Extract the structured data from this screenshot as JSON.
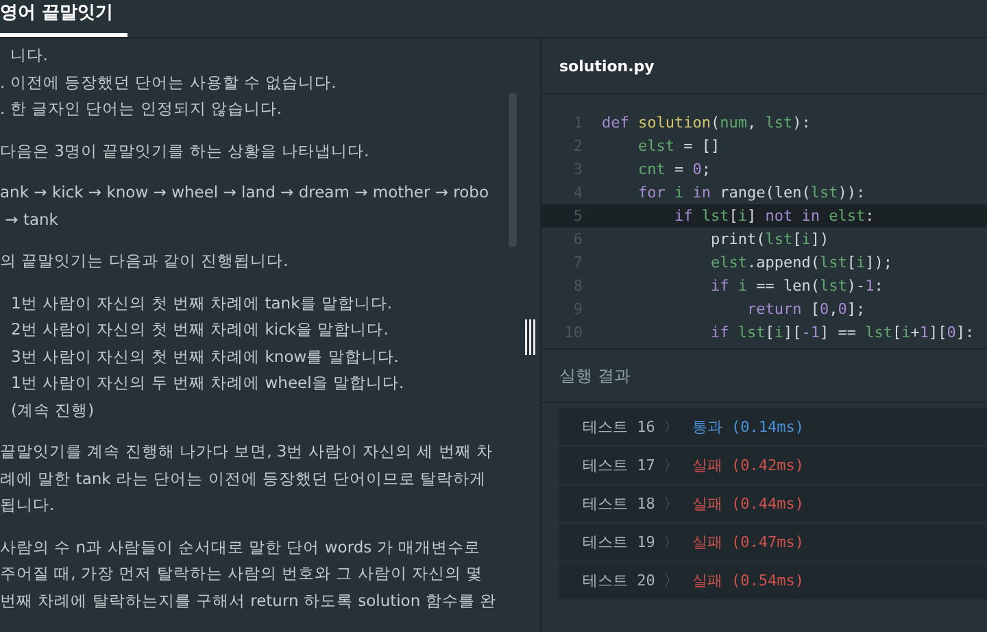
{
  "tabs": [
    {
      "label": "영어 끝말잇기",
      "selected": true
    }
  ],
  "description": {
    "blocks": [
      {
        "kind": "para",
        "text": "  니다."
      },
      {
        "kind": "para",
        "text": ". 이전에 등장했던 단어는 사용할 수 없습니다."
      },
      {
        "kind": "para",
        "text": ". 한 글자인 단어는 인정되지 않습니다."
      },
      {
        "kind": "gap"
      },
      {
        "kind": "para",
        "text": "다음은 3명이 끝말잇기를 하는 상황을 나타냅니다."
      },
      {
        "kind": "gap"
      },
      {
        "kind": "para",
        "text": "ank → kick → know → wheel → land → dream → mother → robo"
      },
      {
        "kind": "para",
        "text": " → tank"
      },
      {
        "kind": "gap"
      },
      {
        "kind": "para",
        "text": "의 끝말잇기는 다음과 같이 진행됩니다."
      },
      {
        "kind": "gap"
      },
      {
        "kind": "item",
        "text": "1번 사람이 자신의 첫 번째 차례에 tank를 말합니다."
      },
      {
        "kind": "item",
        "text": "2번 사람이 자신의 첫 번째 차례에 kick을 말합니다."
      },
      {
        "kind": "item",
        "text": "3번 사람이 자신의 첫 번째 차례에 know를 말합니다."
      },
      {
        "kind": "item",
        "text": "1번 사람이 자신의 두 번째 차례에 wheel을 말합니다."
      },
      {
        "kind": "item",
        "text": "(계속 진행)"
      },
      {
        "kind": "gap"
      },
      {
        "kind": "para",
        "text": "끝말잇기를 계속 진행해 나가다 보면, 3번 사람이 자신의 세 번째 차"
      },
      {
        "kind": "para",
        "text": "례에 말한 tank 라는 단어는 이전에 등장했던 단어이므로 탈락하게"
      },
      {
        "kind": "para",
        "text": "됩니다."
      },
      {
        "kind": "gap"
      },
      {
        "kind": "para",
        "text": "사람의 수 n과 사람들이 순서대로 말한 단어 words 가 매개변수로"
      },
      {
        "kind": "para",
        "text": "주어질 때, 가장 먼저 탈락하는 사람의 번호와 그 사람이 자신의 몇"
      },
      {
        "kind": "para",
        "text": "번째 차례에 탈락하는지를 구해서 return 하도록 solution 함수를 완"
      }
    ]
  },
  "editor": {
    "filename": "solution.py",
    "lines": [
      {
        "number": "1",
        "highlighted": false,
        "tokens": [
          {
            "kind": "kw",
            "text": "def "
          },
          {
            "kind": "fn",
            "text": "solution"
          },
          {
            "kind": "plain",
            "text": "("
          },
          {
            "kind": "var",
            "text": "num"
          },
          {
            "kind": "plain",
            "text": ", "
          },
          {
            "kind": "var",
            "text": "lst"
          },
          {
            "kind": "plain",
            "text": "):"
          }
        ]
      },
      {
        "number": "2",
        "highlighted": false,
        "tokens": [
          {
            "kind": "var",
            "text": "    elst"
          },
          {
            "kind": "plain",
            "text": " = []"
          }
        ]
      },
      {
        "number": "3",
        "highlighted": false,
        "tokens": [
          {
            "kind": "var",
            "text": "    cnt"
          },
          {
            "kind": "plain",
            "text": " = "
          },
          {
            "kind": "num",
            "text": "0"
          },
          {
            "kind": "plain",
            "text": ";"
          }
        ]
      },
      {
        "number": "4",
        "highlighted": false,
        "tokens": [
          {
            "kind": "kw",
            "text": "    for "
          },
          {
            "kind": "var",
            "text": "i"
          },
          {
            "kind": "kw",
            "text": " in "
          },
          {
            "kind": "plain",
            "text": "range(len("
          },
          {
            "kind": "var",
            "text": "lst"
          },
          {
            "kind": "plain",
            "text": ")):"
          }
        ]
      },
      {
        "number": "5",
        "highlighted": true,
        "tokens": [
          {
            "kind": "kw",
            "text": "        if "
          },
          {
            "kind": "var",
            "text": "lst"
          },
          {
            "kind": "plain",
            "text": "["
          },
          {
            "kind": "var",
            "text": "i"
          },
          {
            "kind": "plain",
            "text": "] "
          },
          {
            "kind": "kw",
            "text": "not in "
          },
          {
            "kind": "var",
            "text": "elst"
          },
          {
            "kind": "plain",
            "text": ":"
          }
        ]
      },
      {
        "number": "6",
        "highlighted": false,
        "tokens": [
          {
            "kind": "plain",
            "text": "            print("
          },
          {
            "kind": "var",
            "text": "lst"
          },
          {
            "kind": "plain",
            "text": "["
          },
          {
            "kind": "var",
            "text": "i"
          },
          {
            "kind": "plain",
            "text": "])"
          }
        ]
      },
      {
        "number": "7",
        "highlighted": false,
        "tokens": [
          {
            "kind": "var",
            "text": "            elst"
          },
          {
            "kind": "plain",
            "text": ".append("
          },
          {
            "kind": "var",
            "text": "lst"
          },
          {
            "kind": "plain",
            "text": "["
          },
          {
            "kind": "var",
            "text": "i"
          },
          {
            "kind": "plain",
            "text": "]);"
          }
        ]
      },
      {
        "number": "8",
        "highlighted": false,
        "tokens": [
          {
            "kind": "kw",
            "text": "            if "
          },
          {
            "kind": "var",
            "text": "i"
          },
          {
            "kind": "plain",
            "text": " == len("
          },
          {
            "kind": "var",
            "text": "lst"
          },
          {
            "kind": "plain",
            "text": ")-"
          },
          {
            "kind": "num",
            "text": "1"
          },
          {
            "kind": "plain",
            "text": ":"
          }
        ]
      },
      {
        "number": "9",
        "highlighted": false,
        "tokens": [
          {
            "kind": "kw",
            "text": "                return "
          },
          {
            "kind": "plain",
            "text": "["
          },
          {
            "kind": "num",
            "text": "0"
          },
          {
            "kind": "plain",
            "text": ","
          },
          {
            "kind": "num",
            "text": "0"
          },
          {
            "kind": "plain",
            "text": "];"
          }
        ]
      },
      {
        "number": "10",
        "highlighted": false,
        "tokens": [
          {
            "kind": "kw",
            "text": "            if "
          },
          {
            "kind": "var",
            "text": "lst"
          },
          {
            "kind": "plain",
            "text": "["
          },
          {
            "kind": "var",
            "text": "i"
          },
          {
            "kind": "plain",
            "text": "]["
          },
          {
            "kind": "num",
            "text": "-1"
          },
          {
            "kind": "plain",
            "text": "] == "
          },
          {
            "kind": "var",
            "text": "lst"
          },
          {
            "kind": "plain",
            "text": "["
          },
          {
            "kind": "var",
            "text": "i"
          },
          {
            "kind": "plain",
            "text": "+"
          },
          {
            "kind": "num",
            "text": "1"
          },
          {
            "kind": "plain",
            "text": "]["
          },
          {
            "kind": "num",
            "text": "0"
          },
          {
            "kind": "plain",
            "text": "]:"
          }
        ]
      }
    ]
  },
  "results": {
    "title": "실행 결과",
    "rows": [
      {
        "label": "테스트 16",
        "arrow": "〉",
        "kind": "pass",
        "status": "통과 (0.14ms)"
      },
      {
        "label": "테스트 17",
        "arrow": "〉",
        "kind": "fail",
        "status": "실패 (0.42ms)"
      },
      {
        "label": "테스트 18",
        "arrow": "〉",
        "kind": "fail",
        "status": "실패 (0.44ms)"
      },
      {
        "label": "테스트 19",
        "arrow": "〉",
        "kind": "fail",
        "status": "실패 (0.47ms)"
      },
      {
        "label": "테스트 20",
        "arrow": "〉",
        "kind": "fail",
        "status": "실패 (0.54ms)"
      }
    ]
  }
}
